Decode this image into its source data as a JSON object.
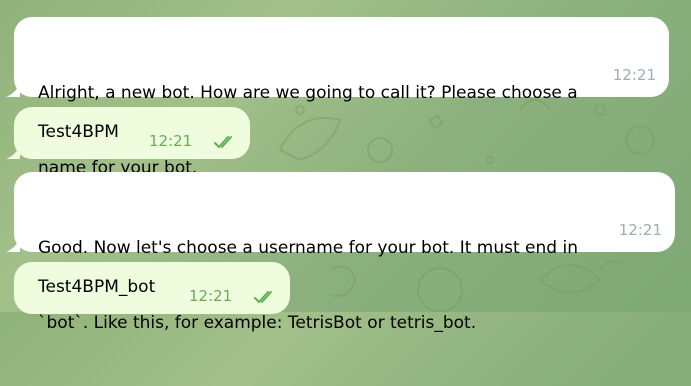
{
  "messages": [
    {
      "direction": "incoming",
      "lines": [
        "Alright, a new bot. How are we going to call it? Please choose a",
        "name for your bot."
      ],
      "time": "12:21"
    },
    {
      "direction": "outgoing",
      "text": "Test4BPM",
      "time": "12:21",
      "status": "read"
    },
    {
      "direction": "incoming",
      "lines": [
        "Good. Now let's choose a username for your bot. It must end in",
        "`bot`. Like this, for example: TetrisBot or tetris_bot."
      ],
      "time": "12:21"
    },
    {
      "direction": "outgoing",
      "text": "Test4BPM_bot",
      "time": "12:21",
      "status": "read"
    }
  ],
  "colors": {
    "incoming_bubble": "#ffffff",
    "outgoing_bubble": "#effdde",
    "outgoing_time": "#5fb053",
    "incoming_time": "#a0acb6",
    "chat_background": "#8fb27a"
  },
  "icons": [
    "double-check-icon"
  ]
}
